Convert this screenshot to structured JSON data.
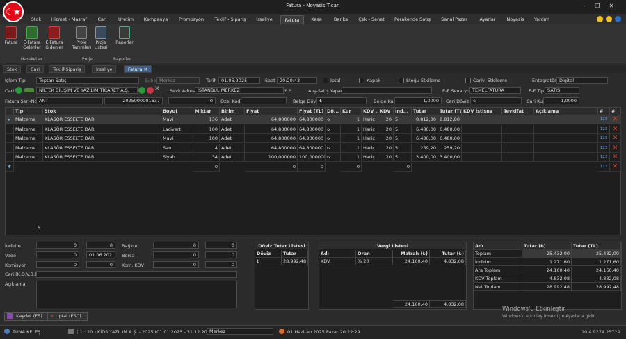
{
  "app": {
    "title": "Fatura - Noyasis Ticari",
    "logo": "☾★"
  },
  "menu": [
    "Stok",
    "Hizmet - Masraf",
    "Cari",
    "Üretim",
    "Kampanya",
    "Promosyon",
    "Teklif - Sipariş",
    "İrsaliye",
    "Fatura",
    "Kasa",
    "Banka",
    "Çek - Senet",
    "Perakende Satış",
    "Sanal Pazar",
    "Ayarlar",
    "Noyasis",
    "Yardım"
  ],
  "ribbon": {
    "buttons": [
      {
        "label": "Fatura"
      },
      {
        "label": "E-Fatura Gelenler"
      },
      {
        "label": "E-Fatura Gidenler"
      },
      {
        "label": "Proje Tanımları"
      },
      {
        "label": "Proje Listesi"
      },
      {
        "label": "Raporlar"
      }
    ],
    "groups": [
      "Hareketler",
      "Proje",
      "Raporlar"
    ]
  },
  "tabs": [
    "Stok",
    "Cari",
    "Teklif-Sipariş",
    "İrsaliye",
    "Fatura"
  ],
  "form": {
    "islem_tipi_label": "İşlem Tipi",
    "islem_tipi": "Toptan Satış",
    "sube_label": "Şube",
    "sube": "Merkez",
    "tarih_label": "Tarih",
    "tarih": "01.06.2025",
    "saat_label": "Saat",
    "saat": "20:20:43",
    "iptal_label": "İptal",
    "kapak_label": "Kapak",
    "stogu_etkileme_label": "Stoğu Etkileme",
    "cariyi_etkileme_label": "Cariyi Etkileme",
    "entegrator_label": "Entegratör",
    "entegrator": "Digital",
    "cari_label": "Cari",
    "cari": "NİLTEK BİLİŞİM VE YAZILIM TİCARET A.Ş.",
    "sevk_label": "Sevk Adresi",
    "sevk": "İSTANBUL MERKEZ",
    "alis_satis_label": "Alış-Satış Yapan",
    "ef_senaryo_label": "E-F Senaryo",
    "ef_senaryo": "TEMELFATURA",
    "ef_tip_label": "E-F Tip",
    "ef_tip": "SATIS",
    "seri_no_label": "Fatura Seri-No",
    "seri": "ANT",
    "no": "2025000001637",
    "seri_extra": "0",
    "ozel_kod_label": "Özel Kod",
    "belge_doviz_label": "Belge Döviz",
    "belge_doviz": "₺",
    "belge_kur_label": "Belge Kur",
    "belge_kur": "1,0000",
    "cari_doviz_label": "Cari Döviz",
    "cari_doviz": "₺",
    "cari_kur_label": "Cari Kur",
    "cari_kur": "1,0000"
  },
  "grid": {
    "headers": [
      "Tip",
      "Stok",
      "Boyut",
      "Miktar",
      "Birim",
      "Fiyat",
      "Fiyat (TL)",
      "Dö...",
      "Kur",
      "KDV ...",
      "KDV",
      "İnd...",
      "Tutar",
      "Tutar (TL)",
      "KDV İstisna",
      "Tevkifat",
      "Açıklama",
      "#",
      "#"
    ],
    "rows": [
      [
        "Malzeme",
        "KLASÖR ESSELTE DAR",
        "Mavi",
        "136",
        "Adet",
        "64,800000",
        "64,800000",
        "₺",
        "1",
        "Hariç",
        "20",
        "5",
        "8.812,80",
        "8.812,80"
      ],
      [
        "Malzeme",
        "KLASÖR ESSELTE DAR",
        "Lacivert",
        "100",
        "Adet",
        "64,800000",
        "64,800000",
        "₺",
        "1",
        "Hariç",
        "20",
        "5",
        "6.480,00",
        "6.480,00"
      ],
      [
        "Malzeme",
        "KLASÖR ESSELTE DAR",
        "Mavi",
        "100",
        "Adet",
        "64,800000",
        "64,800000",
        "₺",
        "1",
        "Hariç",
        "20",
        "5",
        "6.480,00",
        "6.480,00"
      ],
      [
        "Malzeme",
        "KLASÖR ESSELTE DAR",
        "Sarı",
        "4",
        "Adet",
        "64,800000",
        "64,800000",
        "₺",
        "1",
        "Hariç",
        "20",
        "5",
        "259,20",
        "259,20"
      ],
      [
        "Malzeme",
        "KLASÖR ESSELTE DAR",
        "Siyah",
        "34",
        "Adet",
        "100,000000",
        "100,000000",
        "₺",
        "1",
        "Hariç",
        "20",
        "5",
        "3.400,00",
        "3.400,00"
      ]
    ],
    "newrow": {
      "miktar": "0",
      "fiyat": "0",
      "fiyattl": "0",
      "kur": "0",
      "ind": "0"
    },
    "count": "5",
    "rowmark": "▸",
    "row123": "123",
    "rowdel": "✕"
  },
  "bottom": {
    "indirim_label": "İndirim",
    "indirim_a": "0",
    "indirim_b": "0",
    "vade_label": "Vade",
    "vade_a": "0",
    "vade_date": "01.06.202",
    "komisyon_label": "Komisyon",
    "komisyon_a": "0",
    "komisyon_b": "0",
    "bagkur_label": "Bağkur",
    "bagkur_a": "0",
    "bagkur_b": "0",
    "borsa_label": "Borsa",
    "borsa_a": "0",
    "borsa_b": "0",
    "komkdv_label": "Kom. KDV",
    "komkdv_a": "0",
    "komkdv_b": "0",
    "cari_kdv_label": "Cari (K.D.V.B.)",
    "aciklama_label": "Açıklama"
  },
  "doviz": {
    "title": "Döviz Tutar Listesi",
    "h1": "Döviz",
    "h2": "Tutar",
    "c1": "₺",
    "c2": "28.992,48"
  },
  "vergi": {
    "title": "Vergi Listesi",
    "headers": [
      "Adı",
      "Oran",
      "Matrah (₺)",
      "Tutar (₺)"
    ],
    "row": [
      "KDV",
      "% 20",
      "24.160,40",
      "4.832,08"
    ],
    "foot1": "24.160,40",
    "foot2": "4.832,08"
  },
  "totals": {
    "headers": [
      "Adı",
      "Tutar (₺)",
      "Tutar (TL)"
    ],
    "rows": [
      [
        "Toplam",
        "25.432,00",
        "25.432,00"
      ],
      [
        "İndirim",
        "1.271,60",
        "1.271,60"
      ],
      [
        "Ara Toplam",
        "24.160,40",
        "24.160,40"
      ],
      [
        "KDV Toplam",
        "4.832,08",
        "4.832,08"
      ],
      [
        "Net Toplam",
        "28.992,48",
        "28.992,48"
      ]
    ]
  },
  "actions": {
    "save": "Kaydet (F5)",
    "cancel": "İptal (ESC)"
  },
  "status": {
    "user": "TUNA KELEŞ",
    "company": "( 1 : 20 )  KİDS YAZILIM A.Ş. - 2025  (01.01.2025 - 31.12.2025)",
    "branch": "Merkez",
    "datetime": "01 Haziran 2025 Pazar 20:22:29",
    "version": "10.4.9274.25729"
  },
  "watermark": {
    "title": "Windows'u Etkinleştir",
    "sub": "Windows'u etkinleştirmek için Ayarlar'a gidin."
  },
  "colors": {
    "accent": "#3f5f86",
    "delete": "#e04030",
    "flag": "#e30a17"
  }
}
